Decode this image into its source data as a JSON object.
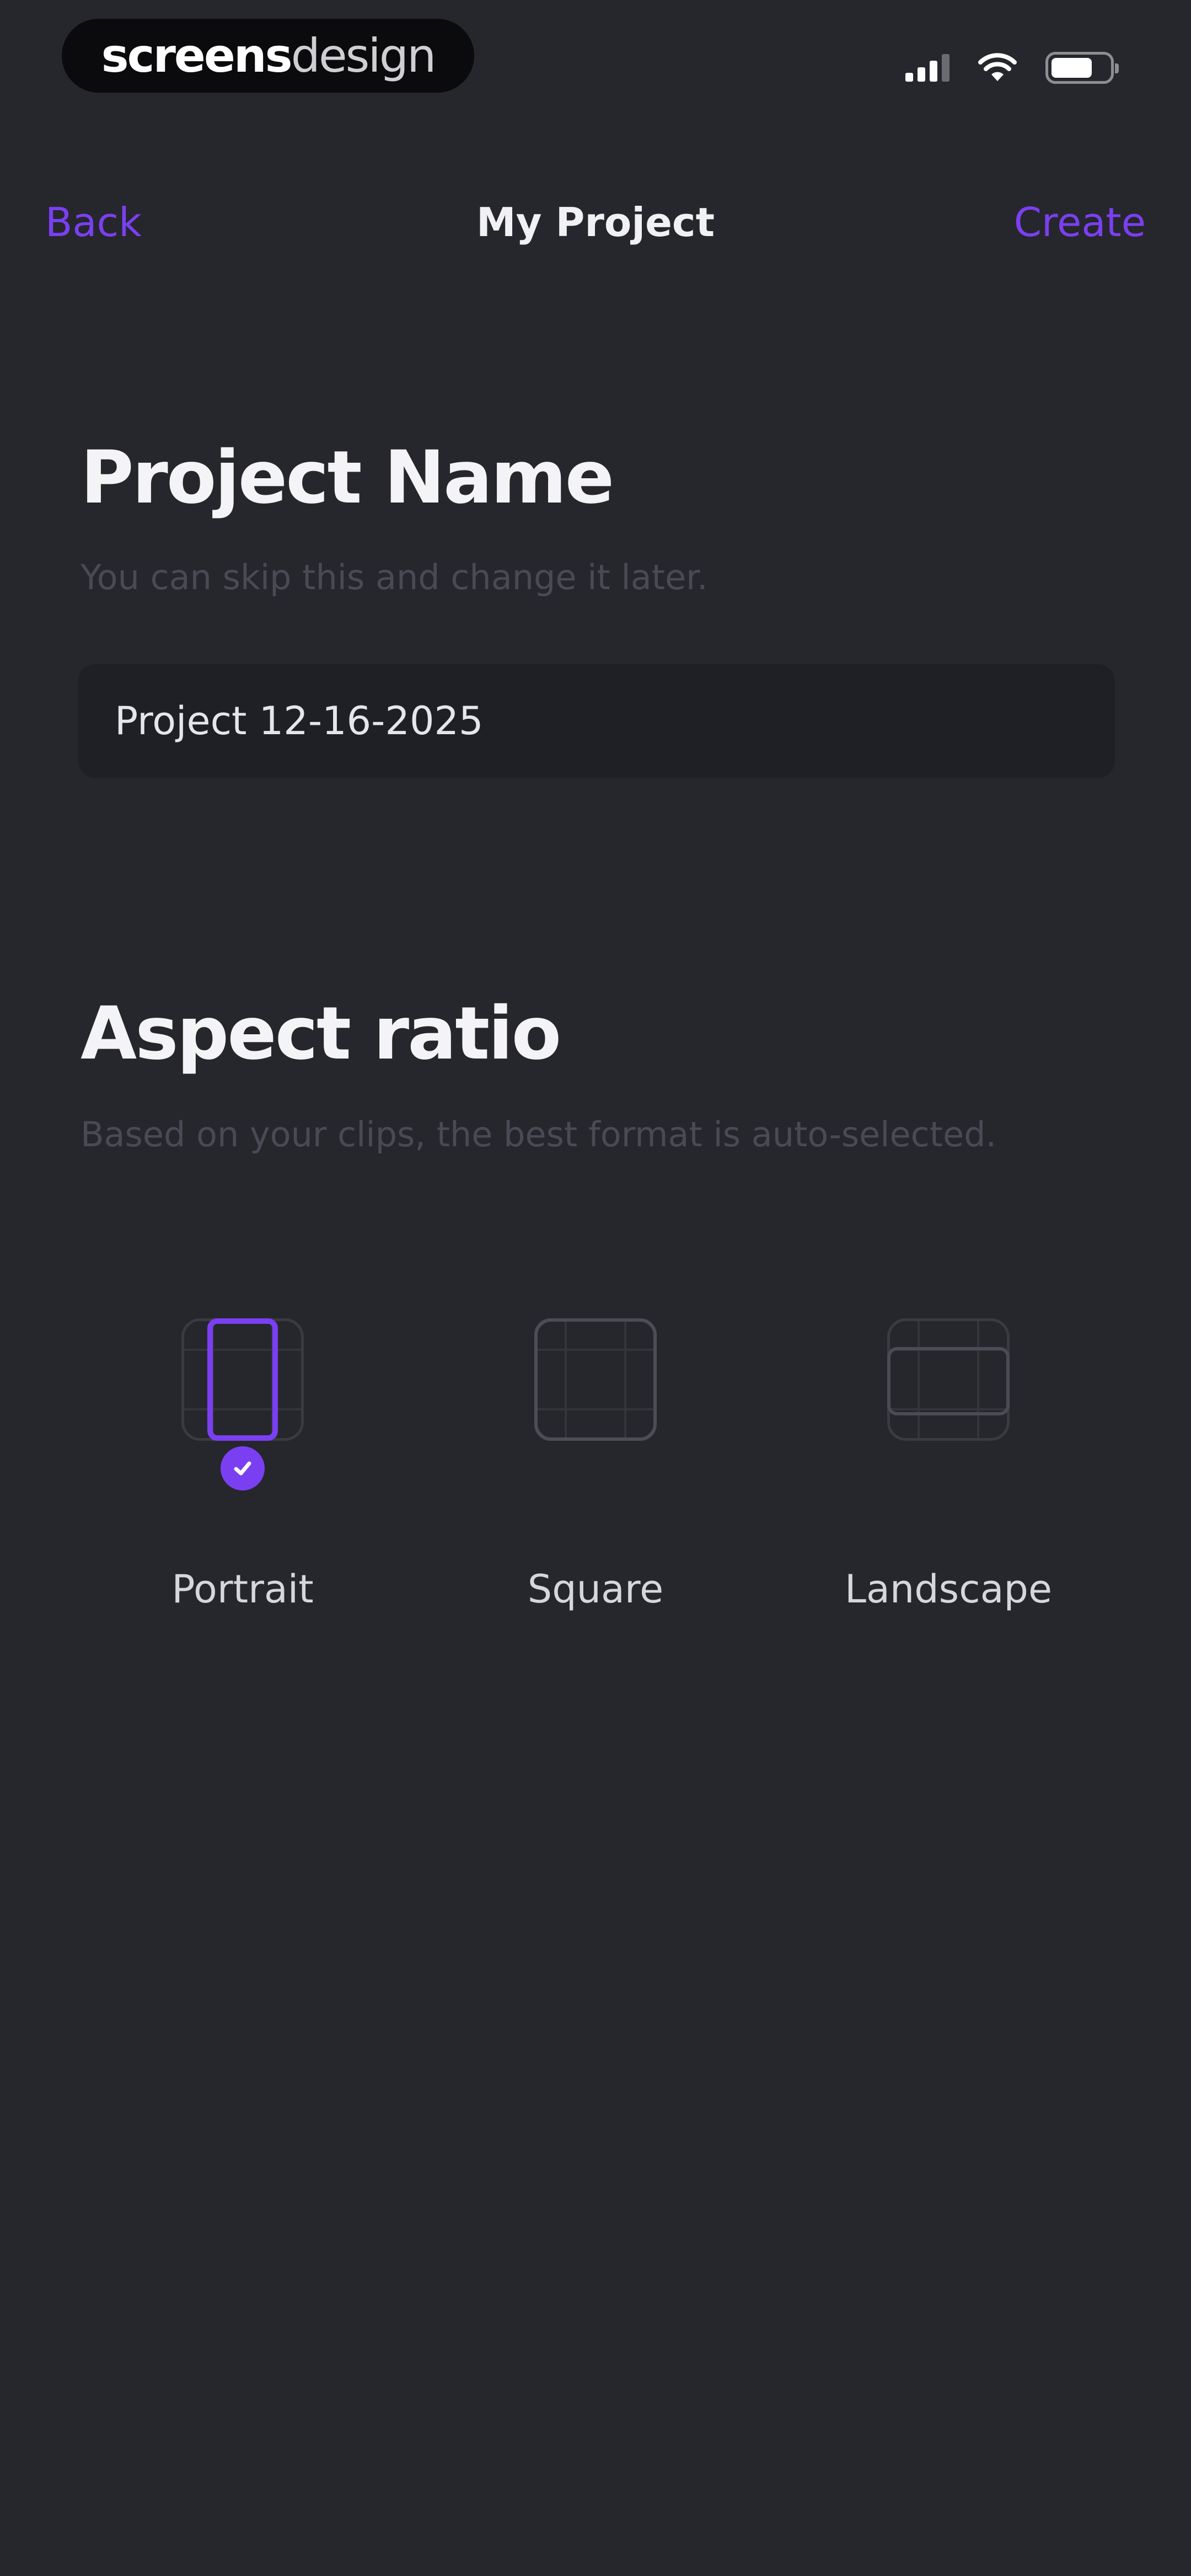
{
  "watermark": {
    "part1": "screens",
    "part2": "design"
  },
  "nav": {
    "back_label": "Back",
    "title": "My Project",
    "create_label": "Create"
  },
  "project_name": {
    "heading": "Project Name",
    "hint": "You can skip this and change it later.",
    "value": "Project 12-16-2025"
  },
  "aspect_ratio": {
    "heading": "Aspect ratio",
    "hint": "Based on your clips, the best format is auto-selected.",
    "selected": "Portrait",
    "options": [
      {
        "label": "Portrait",
        "icon": "portrait-ratio-icon"
      },
      {
        "label": "Square",
        "icon": "square-ratio-icon"
      },
      {
        "label": "Landscape",
        "icon": "landscape-ratio-icon"
      }
    ]
  },
  "colors": {
    "accent": "#7b3ff2",
    "background": "#26272c",
    "field_background": "#1f2025"
  }
}
